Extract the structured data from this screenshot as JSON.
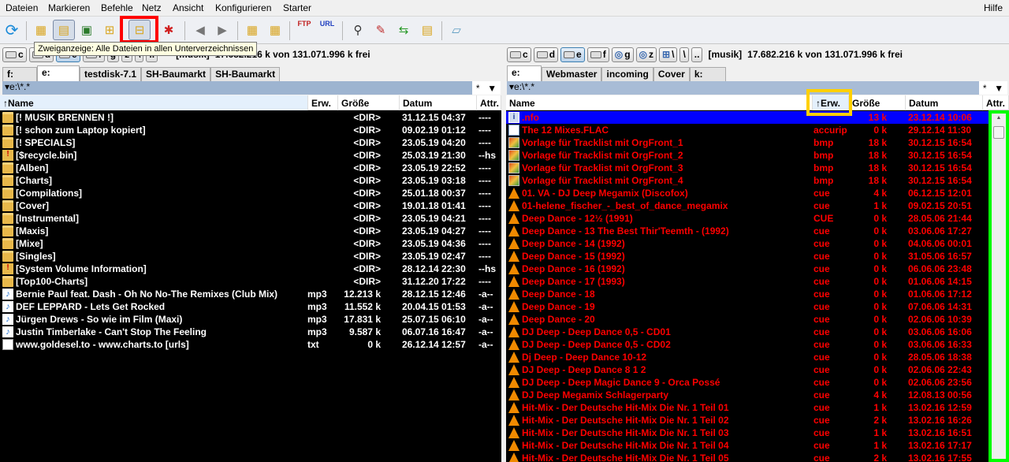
{
  "menu": {
    "items": [
      "Dateien",
      "Markieren",
      "Befehle",
      "Netz",
      "Ansicht",
      "Konfigurieren",
      "Starter"
    ],
    "help": "Hilfe"
  },
  "toolbar": {
    "buttons": [
      "refresh-icon",
      "brief-view-icon",
      "detailed-view-icon",
      "thumbnails-icon",
      "tree-view-icon",
      "branch-view-icon",
      "invert-selection-icon",
      "back-icon",
      "forward-icon",
      "pack-icon",
      "unpack-icon",
      "ftp-connect-icon",
      "url-ftp-icon",
      "search-icon",
      "multi-rename-icon",
      "sync-dirs-icon",
      "copy-names-icon",
      "notepad-icon"
    ],
    "ftp_label": "FTP",
    "url_label": "URL",
    "tooltip": "Zweiganzeige: Alle Dateien in allen Unterverzeichnissen"
  },
  "highlight_colors": {
    "toolbar_button": "#ff0000",
    "erw_header": "#ffd000",
    "scrollbar": "#00ff00"
  },
  "drives": [
    "c",
    "d",
    "e",
    "f",
    "g",
    "z",
    "\\",
    "\\",
    ".."
  ],
  "left": {
    "volume": "[musik]",
    "free": "17.682.216 k von 131.071.996 k frei",
    "tabs": [
      "f:",
      "e:",
      "testdisk-7.1",
      "SH-Baumarkt",
      "SH-Baumarkt"
    ],
    "path": "▾e:\\*.*",
    "filter": "*",
    "headers": {
      "name": "↑Name",
      "ext": "Erw.",
      "size": "Größe",
      "date": "Datum",
      "attr": "Attr."
    },
    "text_color": "#ffffff",
    "rows": [
      {
        "icon": "folder",
        "name": "[! MUSIK BRENNEN !]",
        "ext": "",
        "size": "<DIR>",
        "date": "31.12.15 04:37",
        "attr": "----"
      },
      {
        "icon": "folder",
        "name": "[! schon zum Laptop kopiert]",
        "ext": "",
        "size": "<DIR>",
        "date": "09.02.19 01:12",
        "attr": "----"
      },
      {
        "icon": "folder",
        "name": "[! SPECIALS]",
        "ext": "",
        "size": "<DIR>",
        "date": "23.05.19 04:20",
        "attr": "----"
      },
      {
        "icon": "sysfolder",
        "name": "[$recycle.bin]",
        "ext": "",
        "size": "<DIR>",
        "date": "25.03.19 21:30",
        "attr": "--hs"
      },
      {
        "icon": "folder",
        "name": "[Alben]",
        "ext": "",
        "size": "<DIR>",
        "date": "23.05.19 22:52",
        "attr": "----"
      },
      {
        "icon": "folder",
        "name": "[Charts]",
        "ext": "",
        "size": "<DIR>",
        "date": "23.05.19 03:18",
        "attr": "----"
      },
      {
        "icon": "folder",
        "name": "[Compilations]",
        "ext": "",
        "size": "<DIR>",
        "date": "25.01.18 00:37",
        "attr": "----"
      },
      {
        "icon": "folder",
        "name": "[Cover]",
        "ext": "",
        "size": "<DIR>",
        "date": "19.01.18 01:41",
        "attr": "----"
      },
      {
        "icon": "folder",
        "name": "[Instrumental]",
        "ext": "",
        "size": "<DIR>",
        "date": "23.05.19 04:21",
        "attr": "----"
      },
      {
        "icon": "folder",
        "name": "[Maxis]",
        "ext": "",
        "size": "<DIR>",
        "date": "23.05.19 04:27",
        "attr": "----"
      },
      {
        "icon": "folder",
        "name": "[Mixe]",
        "ext": "",
        "size": "<DIR>",
        "date": "23.05.19 04:36",
        "attr": "----"
      },
      {
        "icon": "folder",
        "name": "[Singles]",
        "ext": "",
        "size": "<DIR>",
        "date": "23.05.19 02:47",
        "attr": "----"
      },
      {
        "icon": "sysfolder",
        "name": "[System Volume Information]",
        "ext": "",
        "size": "<DIR>",
        "date": "28.12.14 22:30",
        "attr": "--hs"
      },
      {
        "icon": "folder",
        "name": "[Top100-Charts]",
        "ext": "",
        "size": "<DIR>",
        "date": "31.12.20 17:22",
        "attr": "----"
      },
      {
        "icon": "audio",
        "name": "Bernie Paul feat. Dash - Oh No No-The Remixes (Club Mix)",
        "ext": "mp3",
        "size": "12.213 k",
        "date": "28.12.15 12:46",
        "attr": "-a--"
      },
      {
        "icon": "audio",
        "name": "DEF LEPPARD - Lets Get Rocked",
        "ext": "mp3",
        "size": "11.552 k",
        "date": "20.04.15 01:53",
        "attr": "-a--"
      },
      {
        "icon": "audio",
        "name": "Jürgen Drews - So wie im Film (Maxi)",
        "ext": "mp3",
        "size": "17.831 k",
        "date": "25.07.15 06:10",
        "attr": "-a--"
      },
      {
        "icon": "audio",
        "name": "Justin Timberlake - Can't Stop The Feeling",
        "ext": "mp3",
        "size": "9.587 k",
        "date": "06.07.16 16:47",
        "attr": "-a--"
      },
      {
        "icon": "text",
        "name": "www.goldesel.to - www.charts.to [urls]",
        "ext": "txt",
        "size": "0 k",
        "date": "26.12.14 12:57",
        "attr": "-a--"
      }
    ]
  },
  "right": {
    "volume": "[musik]",
    "free": "17.682.216 k von 131.071.996 k frei",
    "tabs": [
      "e:",
      "Webmaster",
      "incoming",
      "Cover",
      "k:"
    ],
    "path": "▾e:\\*.*",
    "filter": "*",
    "headers": {
      "name": "Name",
      "ext": "↑Erw.",
      "size": "Größe",
      "date": "Datum",
      "attr": "Attr."
    },
    "text_color": "#ff0000",
    "selection_color": "#0000ff",
    "rows": [
      {
        "icon": "info",
        "name": ".nfo",
        "ext": "",
        "size": "13 k",
        "date": "23.12.14 10:06",
        "selected": true
      },
      {
        "icon": "doc",
        "name": "The 12  Mixes.FLAC",
        "ext": "accurip",
        "size": "0 k",
        "date": "29.12.14 11:30"
      },
      {
        "icon": "bmp",
        "name": "Vorlage für Tracklist mit OrgFront_1",
        "ext": "bmp",
        "size": "18 k",
        "date": "30.12.15 16:54"
      },
      {
        "icon": "bmp",
        "name": "Vorlage für Tracklist mit OrgFront_2",
        "ext": "bmp",
        "size": "18 k",
        "date": "30.12.15 16:54"
      },
      {
        "icon": "bmp",
        "name": "Vorlage für Tracklist mit OrgFront_3",
        "ext": "bmp",
        "size": "18 k",
        "date": "30.12.15 16:54"
      },
      {
        "icon": "bmp",
        "name": "Vorlage für Tracklist mit OrgFront_4",
        "ext": "bmp",
        "size": "18 k",
        "date": "30.12.15 16:54"
      },
      {
        "icon": "vlc",
        "name": "01. VA - DJ Deep Megamix (Discofox)",
        "ext": "cue",
        "size": "4 k",
        "date": "06.12.15 12:01"
      },
      {
        "icon": "vlc",
        "name": "01-helene_fischer_-_best_of_dance_megamix",
        "ext": "cue",
        "size": "1 k",
        "date": "09.02.15 20:51"
      },
      {
        "icon": "vlc",
        "name": "Deep Dance - 12½ (1991)",
        "ext": "CUE",
        "size": "0 k",
        "date": "28.05.06 21:44"
      },
      {
        "icon": "vlc",
        "name": "Deep Dance - 13 The Best Thir'Teemth - (1992)",
        "ext": "cue",
        "size": "0 k",
        "date": "03.06.06 17:27"
      },
      {
        "icon": "vlc",
        "name": "Deep Dance - 14 (1992)",
        "ext": "cue",
        "size": "0 k",
        "date": "04.06.06 00:01"
      },
      {
        "icon": "vlc",
        "name": "Deep Dance - 15 (1992)",
        "ext": "cue",
        "size": "0 k",
        "date": "31.05.06 16:57"
      },
      {
        "icon": "vlc",
        "name": "Deep Dance - 16 (1992)",
        "ext": "cue",
        "size": "0 k",
        "date": "06.06.06 23:48"
      },
      {
        "icon": "vlc",
        "name": "Deep Dance - 17 (1993)",
        "ext": "cue",
        "size": "0 k",
        "date": "01.06.06 14:15"
      },
      {
        "icon": "vlc",
        "name": "Deep Dance - 18",
        "ext": "cue",
        "size": "0 k",
        "date": "01.06.06 17:12"
      },
      {
        "icon": "vlc",
        "name": "Deep Dance - 19",
        "ext": "cue",
        "size": "0 k",
        "date": "07.06.06 14:31"
      },
      {
        "icon": "vlc",
        "name": "Deep Dance - 20",
        "ext": "cue",
        "size": "0 k",
        "date": "02.06.06 10:39"
      },
      {
        "icon": "vlc",
        "name": "DJ Deep - Deep Dance 0,5 - CD01",
        "ext": "cue",
        "size": "0 k",
        "date": "03.06.06 16:06"
      },
      {
        "icon": "vlc",
        "name": "DJ Deep - Deep Dance 0,5 - CD02",
        "ext": "cue",
        "size": "0 k",
        "date": "03.06.06 16:33"
      },
      {
        "icon": "vlc",
        "name": "Dj Deep - Deep Dance 10-12",
        "ext": "cue",
        "size": "0 k",
        "date": "28.05.06 18:38"
      },
      {
        "icon": "vlc",
        "name": "DJ Deep - Deep Dance 8 1 2",
        "ext": "cue",
        "size": "0 k",
        "date": "02.06.06 22:43"
      },
      {
        "icon": "vlc",
        "name": "DJ Deep - Deep Magic Dance 9 - Orca Possé",
        "ext": "cue",
        "size": "0 k",
        "date": "02.06.06 23:56"
      },
      {
        "icon": "vlc",
        "name": "DJ Deep Megamix Schlagerparty",
        "ext": "cue",
        "size": "4 k",
        "date": "12.08.13 00:56"
      },
      {
        "icon": "vlc",
        "name": "Hit-Mix - Der Deutsche Hit-Mix Die Nr. 1 Teil 01",
        "ext": "cue",
        "size": "1 k",
        "date": "13.02.16 12:59"
      },
      {
        "icon": "vlc",
        "name": "Hit-Mix - Der Deutsche Hit-Mix Die Nr. 1 Teil 02",
        "ext": "cue",
        "size": "2 k",
        "date": "13.02.16 16:26"
      },
      {
        "icon": "vlc",
        "name": "Hit-Mix - Der Deutsche Hit-Mix Die Nr. 1 Teil 03",
        "ext": "cue",
        "size": "1 k",
        "date": "13.02.16 16:51"
      },
      {
        "icon": "vlc",
        "name": "Hit-Mix - Der Deutsche Hit-Mix Die Nr. 1 Teil 04",
        "ext": "cue",
        "size": "1 k",
        "date": "13.02.16 17:17"
      },
      {
        "icon": "vlc",
        "name": "Hit-Mix - Der Deutsche Hit-Mix Die Nr. 1 Teil 05",
        "ext": "cue",
        "size": "2 k",
        "date": "13.02.16 17:55"
      }
    ]
  }
}
